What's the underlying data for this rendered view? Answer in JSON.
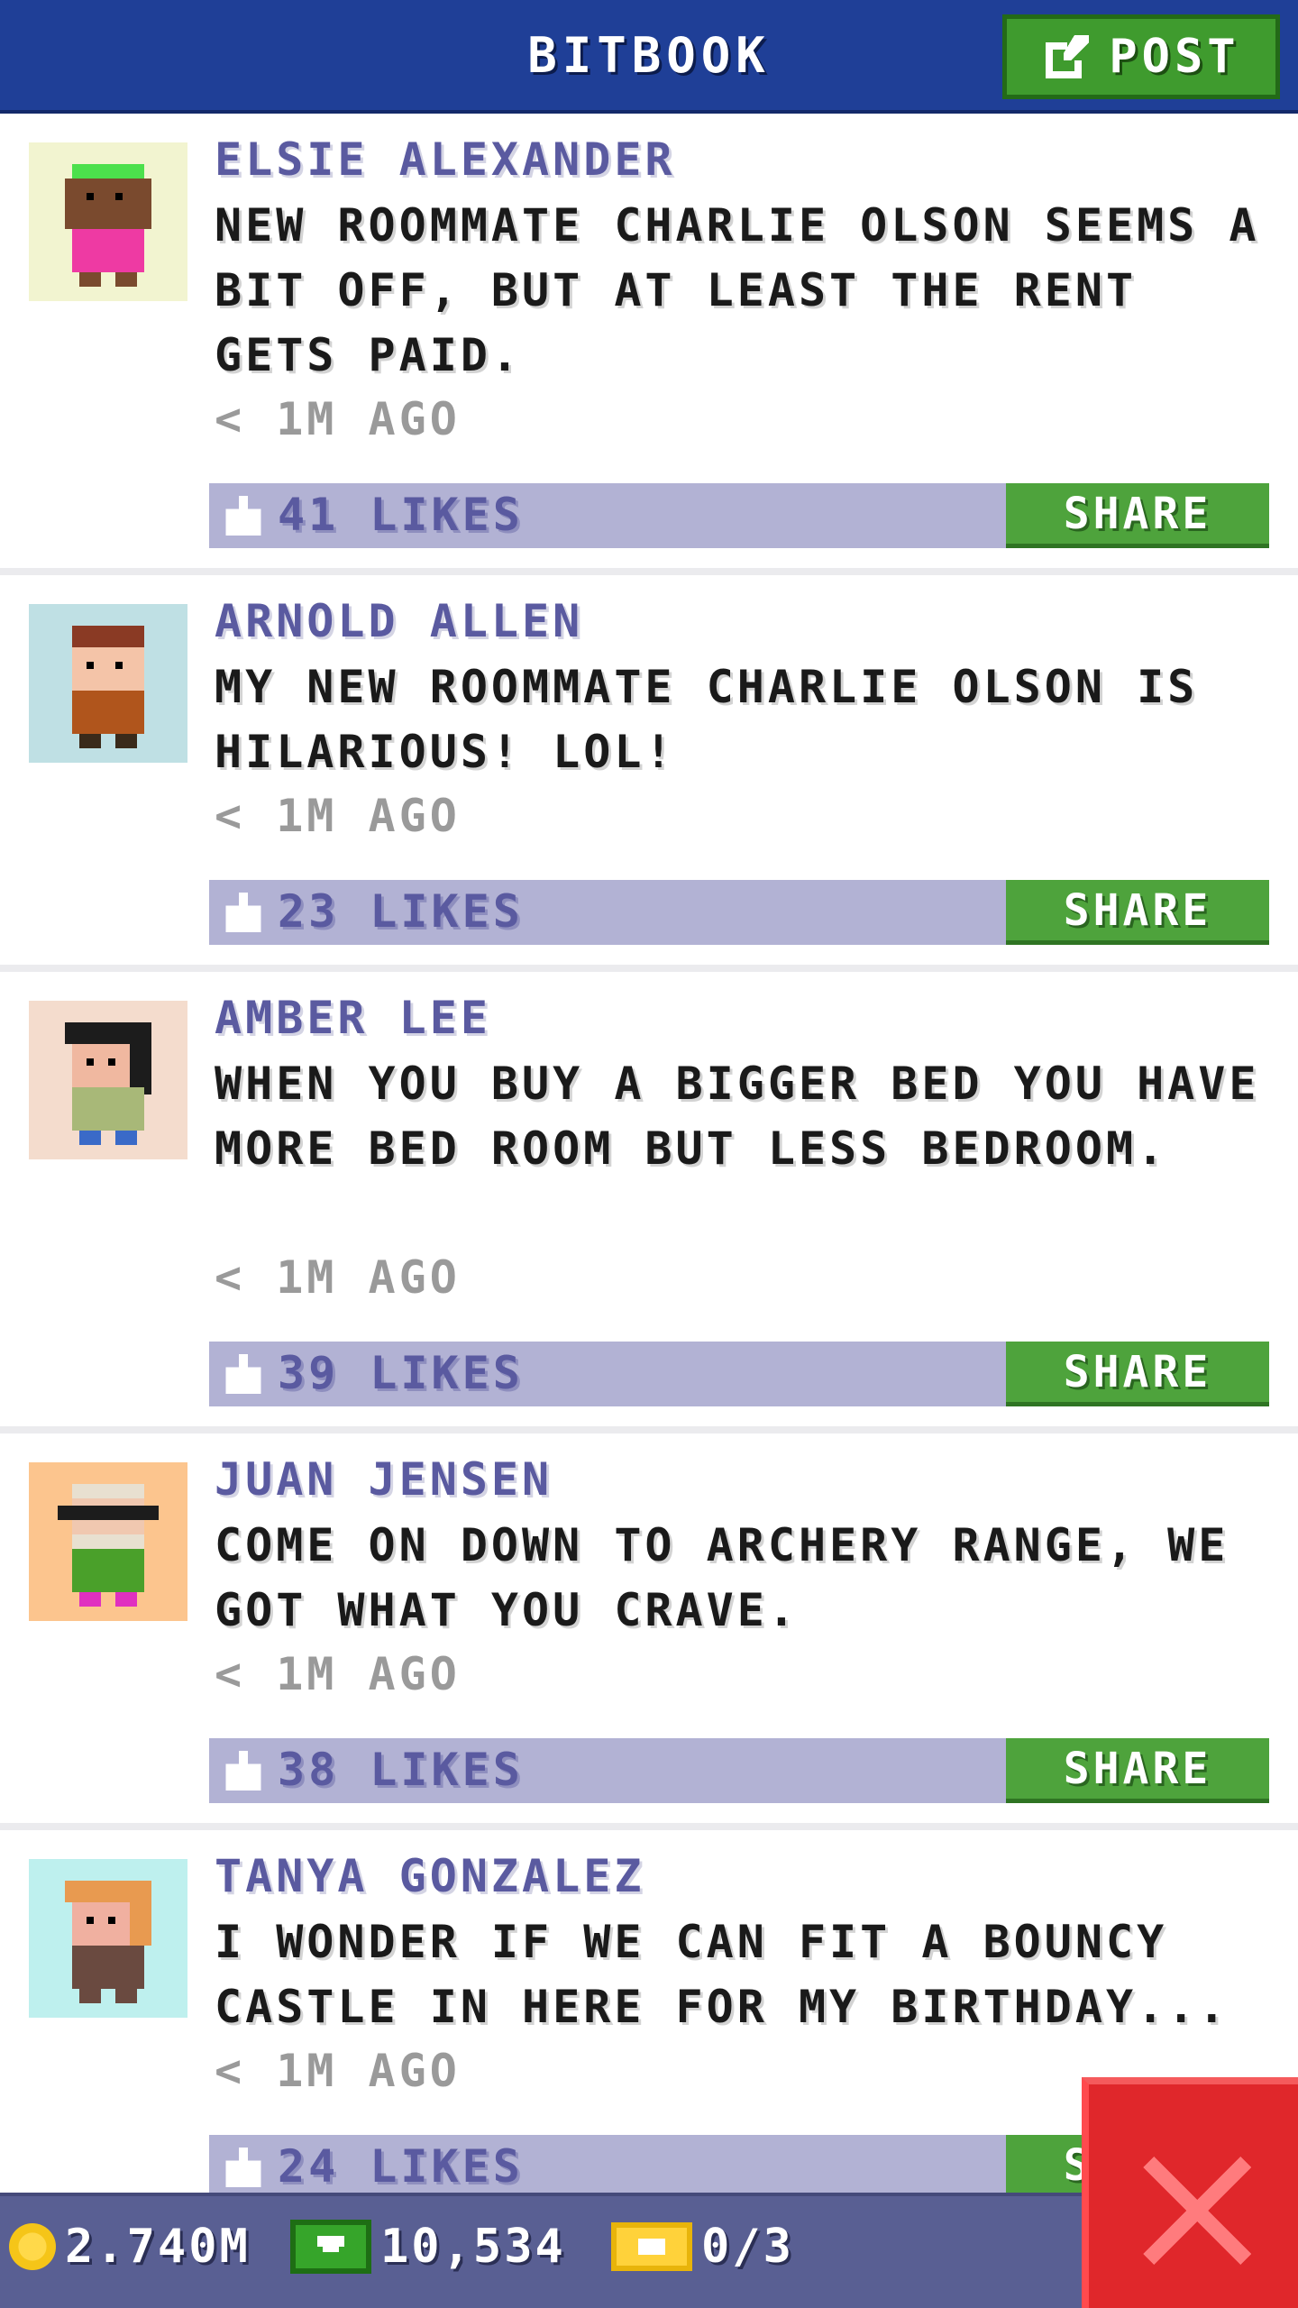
{
  "header": {
    "title": "BITBOOK",
    "post_label": "POST"
  },
  "posts": [
    {
      "author": "ELSIE ALEXANDER",
      "text": "NEW ROOMMATE CHARLIE OLSON SEEMS A BIT OFF, BUT AT LEAST THE RENT GETS PAID.",
      "time": "< 1M AGO",
      "likes": "41 LIKES",
      "share_label": "SHARE",
      "avatar_bg": "#f2f4d0"
    },
    {
      "author": "ARNOLD ALLEN",
      "text": "MY NEW ROOMMATE CHARLIE OLSON IS HILARIOUS! LOL!",
      "time": "< 1M AGO",
      "likes": "23 LIKES",
      "share_label": "SHARE",
      "avatar_bg": "#bfe0e4"
    },
    {
      "author": "AMBER LEE",
      "text": "WHEN YOU BUY A BIGGER BED YOU HAVE MORE BED ROOM BUT LESS BEDROOM.",
      "time": "< 1M AGO",
      "likes": "39 LIKES",
      "share_label": "SHARE",
      "avatar_bg": "#f4dccd"
    },
    {
      "author": "JUAN JENSEN",
      "text": "COME ON DOWN TO ARCHERY RANGE, WE GOT WHAT YOU CRAVE.",
      "time": "< 1M AGO",
      "likes": "38 LIKES",
      "share_label": "SHARE",
      "avatar_bg": "#fcc58e"
    },
    {
      "author": "TANYA GONZALEZ",
      "text": "I WONDER IF WE CAN FIT A BOUNCY CASTLE IN HERE FOR MY BIRTHDAY...",
      "time": "< 1M AGO",
      "likes": "24 LIKES",
      "share_label": "SHARE",
      "avatar_bg": "#bef0ee"
    }
  ],
  "footer": {
    "coins": "2.740M",
    "bux": "10,534",
    "tickets": "0/3"
  },
  "icons": {
    "post": "edit-icon",
    "like": "thumb-icon",
    "coins": "coin-icon",
    "bux": "bux-icon",
    "tickets": "ticket-icon",
    "close": "close-icon"
  }
}
